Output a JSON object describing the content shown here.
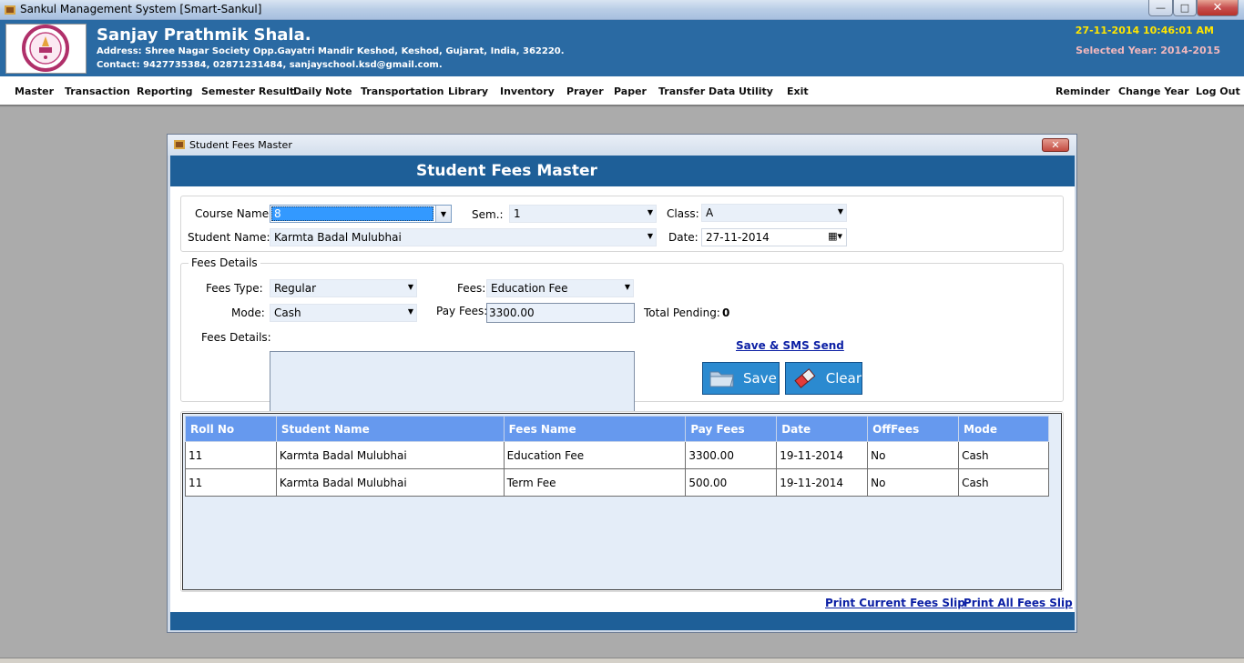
{
  "window": {
    "title": "Sankul Management System [Smart-Sankul]",
    "minimize_label": "—",
    "maximize_label": "□",
    "close_label": "✕"
  },
  "header": {
    "school_name": "Sanjay Prathmik Shala.",
    "address": "Address: Shree Nagar Society  Opp.Gayatri Mandir Keshod, Keshod, Gujarat, India, 362220.",
    "contact": "Contact: 9427735384, 02871231484, sanjayschool.ksd@gmail.com.",
    "datetime": "27-11-2014 10:46:01 AM",
    "selected_year": "Selected Year: 2014-2015"
  },
  "menu": {
    "left": [
      "Master",
      "Transaction",
      "Reporting",
      "Semester Result",
      "Daily Note",
      "Transportation",
      "Library",
      "Inventory",
      "Prayer",
      "Paper",
      "Transfer Data",
      "Utility",
      "Exit"
    ],
    "right": [
      "Reminder",
      "Change Year",
      "Log Out"
    ]
  },
  "dialog": {
    "window_title": "Student Fees Master",
    "form_title": "Student Fees Master",
    "close_label": "✕",
    "course_label": "Course Name:",
    "course_value": "8",
    "sem_label": "Sem.:",
    "sem_value": "1",
    "class_label": "Class:",
    "class_value": "A",
    "student_label": "Student Name:",
    "student_value": "Karmta Badal Mulubhai",
    "date_label": "Date:",
    "date_value": "27-11-2014",
    "fees_group_label": "Fees Details",
    "fees_type_label": "Fees Type:",
    "fees_type_value": "Regular",
    "fees_label": "Fees:",
    "fees_value": "Education Fee",
    "mode_label": "Mode:",
    "mode_value": "Cash",
    "pay_fees_label": "Pay Fees:",
    "pay_fees_value": "3300.00",
    "total_pending_label": "Total Pending:",
    "total_pending_value": "0",
    "fees_details_label": "Fees Details:",
    "fees_details_value": "",
    "save_sms_link": "Save & SMS Send",
    "save_button": "Save",
    "clear_button": "Clear",
    "print_current_link": "Print Current Fees Slip",
    "print_all_link": "Print All Fees Slip"
  },
  "table": {
    "headers": [
      "Roll No",
      "Student Name",
      "Fees Name",
      "Pay Fees",
      "Date",
      "OffFees",
      "Mode"
    ],
    "rows": [
      [
        "11",
        "Karmta Badal Mulubhai",
        "Education Fee",
        "3300.00",
        "19-11-2014",
        "No",
        "Cash"
      ],
      [
        "11",
        "Karmta Badal Mulubhai",
        "Term Fee",
        "500.00",
        "19-11-2014",
        "No",
        "Cash"
      ]
    ]
  }
}
